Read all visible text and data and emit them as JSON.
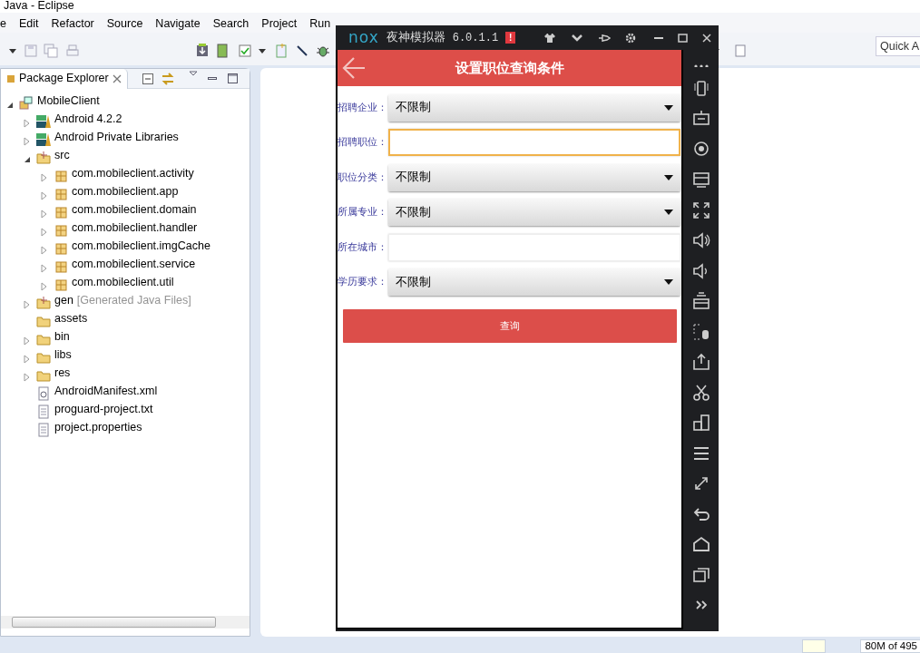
{
  "eclipse": {
    "title": "Java - Eclipse",
    "menu": [
      "e",
      "Edit",
      "Refactor",
      "Source",
      "Navigate",
      "Search",
      "Project",
      "Run"
    ],
    "quick_access": {
      "placeholder": "Quick A"
    },
    "explorer": {
      "tab": "Package Explorer",
      "tree": [
        {
          "label": "MobileClient",
          "kind": "project",
          "expanded": true,
          "children": [
            {
              "label": "Android 4.2.2",
              "kind": "library",
              "expanded": false
            },
            {
              "label": "Android Private Libraries",
              "kind": "library",
              "expanded": false
            },
            {
              "label": "src",
              "kind": "source-folder",
              "expanded": true,
              "children": [
                {
                  "label": "com.mobileclient.activity",
                  "kind": "package",
                  "expanded": false
                },
                {
                  "label": "com.mobileclient.app",
                  "kind": "package",
                  "expanded": false
                },
                {
                  "label": "com.mobileclient.domain",
                  "kind": "package",
                  "expanded": false
                },
                {
                  "label": "com.mobileclient.handler",
                  "kind": "package",
                  "expanded": false
                },
                {
                  "label": "com.mobileclient.imgCache",
                  "kind": "package",
                  "expanded": false
                },
                {
                  "label": "com.mobileclient.service",
                  "kind": "package",
                  "expanded": false
                },
                {
                  "label": "com.mobileclient.util",
                  "kind": "package",
                  "expanded": false
                }
              ]
            },
            {
              "label": "gen",
              "decoration": "[Generated Java Files]",
              "kind": "source-folder",
              "expanded": false
            },
            {
              "label": "assets",
              "kind": "folder"
            },
            {
              "label": "bin",
              "kind": "folder",
              "expanded": false
            },
            {
              "label": "libs",
              "kind": "folder",
              "expanded": false
            },
            {
              "label": "res",
              "kind": "folder",
              "expanded": false
            },
            {
              "label": "AndroidManifest.xml",
              "kind": "xml-file"
            },
            {
              "label": "proguard-project.txt",
              "kind": "text-file"
            },
            {
              "label": "project.properties",
              "kind": "text-file"
            }
          ]
        }
      ]
    },
    "status_bar": {
      "memory": "80M of 495"
    }
  },
  "emulator": {
    "logo": "nox",
    "title": "夜神模拟器",
    "version": "6.0.1.1",
    "alert": "!",
    "app": {
      "title": "设置职位查询条件",
      "fields": [
        {
          "label": "招聘企业：",
          "kind": "dropdown",
          "value": "不限制"
        },
        {
          "label": "招聘职位：",
          "kind": "text",
          "focused": true
        },
        {
          "label": "职位分类：",
          "kind": "dropdown",
          "value": "不限制"
        },
        {
          "label": "所属专业：",
          "kind": "dropdown",
          "value": "不限制"
        },
        {
          "label": "所在城市：",
          "kind": "text",
          "focused": false
        },
        {
          "label": "学历要求：",
          "kind": "dropdown",
          "value": "不限制"
        }
      ],
      "button": "查询"
    }
  }
}
